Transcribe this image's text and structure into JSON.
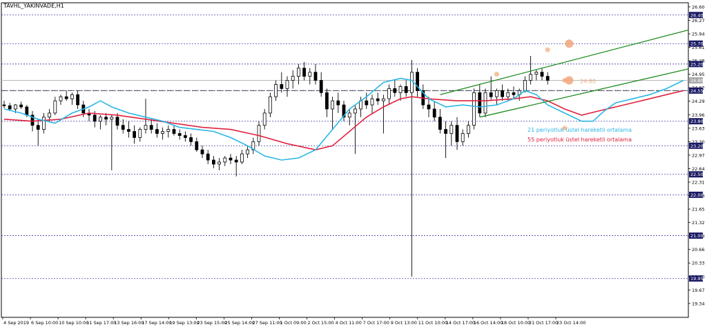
{
  "chart_data": {
    "type": "candlestick",
    "title": "TAVHL_YAKINVADE,H1",
    "ylim": [
      19.0,
      26.7
    ],
    "y_ticks": [
      "26.60",
      "26.27",
      "25.94",
      "25.61",
      "25.28",
      "24.95",
      "24.62",
      "24.29",
      "23.96",
      "23.63",
      "23.30",
      "22.97",
      "22.64",
      "22.31",
      "21.98",
      "21.65",
      "21.32",
      "20.99",
      "20.66",
      "20.33",
      "20.00",
      "19.67",
      "19.34"
    ],
    "price_labels": [
      {
        "label": "26.40",
        "value": 26.4,
        "color": "#1a1a66"
      },
      {
        "label": "25.70",
        "value": 25.7,
        "color": "#1a1a66"
      },
      {
        "label": "25.20",
        "value": 25.2,
        "color": "#1a1a66"
      },
      {
        "label": "24.80",
        "value": 24.8,
        "color": "#a8a8a8"
      },
      {
        "label": "24.55",
        "value": 24.55,
        "color": "#1a1a66"
      },
      {
        "label": "23.80",
        "value": 23.8,
        "color": "#1a1a66"
      },
      {
        "label": "23.20",
        "value": 23.2,
        "color": "#1a1a66"
      },
      {
        "label": "22.50",
        "value": 22.5,
        "color": "#1a1a66"
      },
      {
        "label": "22.00",
        "value": 22.0,
        "color": "#1a1a66"
      },
      {
        "label": "21.00",
        "value": 21.0,
        "color": "#1a1a66"
      },
      {
        "label": "19.95",
        "value": 19.95,
        "color": "#1a1a66"
      }
    ],
    "x_ticks": [
      "4 Sep 2019",
      "6 Sep 10:00",
      "10 Sep 10:00",
      "11 Sep 17:00",
      "13 Sep 16:00",
      "17 Sep 14:00",
      "19 Sep 13:00",
      "23 Sep 15:00",
      "25 Sep 14:00",
      "27 Sep 11:00",
      "1 Oct 09:00",
      "2 Oct 15:00",
      "4 Oct 11:00",
      "7 Oct 17:00",
      "9 Oct 13:00",
      "11 Oct 10:00",
      "14 Oct 17:00",
      "16 Oct 14:00",
      "18 Oct 10:00",
      "21 Oct 17:00",
      "23 Oct 14:00"
    ],
    "support_resistance": [
      26.4,
      25.7,
      25.2,
      24.55,
      23.8,
      23.2,
      22.5,
      22.0,
      21.0,
      19.95
    ],
    "dashed_level": 24.55,
    "gray_level": 24.8,
    "ema21_color": "#29b6e6",
    "ema55_color": "#e0203c",
    "channel_color": "#1d8a1d",
    "marker_color": "#f2a678",
    "annotations": {
      "level_text": "24.80",
      "ema21_legend": "21 periyotluk üstel hareketli ortalama",
      "ema55_legend": "55 periyotluk üstel hareketli ortalama"
    },
    "ema21": [
      [
        0,
        24.1
      ],
      [
        3,
        24.0
      ],
      [
        6,
        23.85
      ],
      [
        9,
        23.75
      ],
      [
        12,
        24.0
      ],
      [
        15,
        24.15
      ],
      [
        17,
        24.3
      ],
      [
        19,
        24.15
      ],
      [
        22,
        24.0
      ],
      [
        25,
        23.9
      ],
      [
        28,
        23.8
      ],
      [
        31,
        23.65
      ],
      [
        34,
        23.6
      ],
      [
        37,
        23.55
      ],
      [
        40,
        23.4
      ],
      [
        43,
        23.2
      ],
      [
        46,
        22.95
      ],
      [
        49,
        22.85
      ],
      [
        52,
        22.9
      ],
      [
        55,
        23.1
      ],
      [
        58,
        23.6
      ],
      [
        61,
        24.1
      ],
      [
        64,
        24.4
      ],
      [
        67,
        24.75
      ],
      [
        70,
        24.85
      ],
      [
        72,
        24.8
      ],
      [
        75,
        24.35
      ],
      [
        78,
        24.15
      ],
      [
        81,
        24.2
      ],
      [
        84,
        24.15
      ],
      [
        87,
        24.2
      ],
      [
        90,
        24.35
      ],
      [
        92,
        24.55
      ],
      [
        94,
        24.45
      ],
      [
        96,
        24.2
      ],
      [
        99,
        24.0
      ],
      [
        102,
        23.8
      ],
      [
        104,
        23.8
      ],
      [
        106,
        24.05
      ],
      [
        108,
        24.25
      ],
      [
        111,
        24.35
      ],
      [
        114,
        24.45
      ],
      [
        117,
        24.6
      ],
      [
        120,
        24.8
      ]
    ],
    "ema55": [
      [
        0,
        23.85
      ],
      [
        5,
        23.8
      ],
      [
        10,
        23.85
      ],
      [
        15,
        24.0
      ],
      [
        20,
        23.95
      ],
      [
        25,
        23.85
      ],
      [
        30,
        23.75
      ],
      [
        35,
        23.65
      ],
      [
        40,
        23.6
      ],
      [
        45,
        23.45
      ],
      [
        50,
        23.25
      ],
      [
        55,
        23.1
      ],
      [
        58,
        23.2
      ],
      [
        61,
        23.55
      ],
      [
        64,
        23.9
      ],
      [
        67,
        24.15
      ],
      [
        70,
        24.35
      ],
      [
        72,
        24.4
      ],
      [
        75,
        24.35
      ],
      [
        80,
        24.3
      ],
      [
        85,
        24.3
      ],
      [
        90,
        24.35
      ],
      [
        93,
        24.4
      ],
      [
        96,
        24.3
      ],
      [
        99,
        24.1
      ],
      [
        102,
        23.95
      ],
      [
        105,
        24.05
      ],
      [
        108,
        24.15
      ],
      [
        111,
        24.25
      ],
      [
        114,
        24.35
      ],
      [
        117,
        24.45
      ],
      [
        120,
        24.55
      ]
    ],
    "candles": [
      [
        24.2,
        24.3,
        24.12,
        24.18
      ],
      [
        24.18,
        24.25,
        24.05,
        24.1
      ],
      [
        24.1,
        24.22,
        24.0,
        24.2
      ],
      [
        24.2,
        24.28,
        24.1,
        24.15
      ],
      [
        24.15,
        24.2,
        23.9,
        23.95
      ],
      [
        23.95,
        24.05,
        23.55,
        23.7
      ],
      [
        23.7,
        23.85,
        23.2,
        23.6
      ],
      [
        23.6,
        24.0,
        23.5,
        23.9
      ],
      [
        23.9,
        24.1,
        23.8,
        24.0
      ],
      [
        24.0,
        24.4,
        23.95,
        24.3
      ],
      [
        24.3,
        24.45,
        24.2,
        24.4
      ],
      [
        24.4,
        24.55,
        24.3,
        24.35
      ],
      [
        24.35,
        24.5,
        24.2,
        24.45
      ],
      [
        24.45,
        24.55,
        24.1,
        24.2
      ],
      [
        24.2,
        24.3,
        23.9,
        24.0
      ],
      [
        24.0,
        24.1,
        23.8,
        23.95
      ],
      [
        23.95,
        24.05,
        23.65,
        23.8
      ],
      [
        23.8,
        23.95,
        23.6,
        23.9
      ],
      [
        23.9,
        24.0,
        23.7,
        23.85
      ],
      [
        23.85,
        23.95,
        22.6,
        23.9
      ],
      [
        23.9,
        24.0,
        23.6,
        23.7
      ],
      [
        23.7,
        23.85,
        23.5,
        23.6
      ],
      [
        23.6,
        23.8,
        23.4,
        23.55
      ],
      [
        23.55,
        23.7,
        23.25,
        23.4
      ],
      [
        23.4,
        23.65,
        23.3,
        23.6
      ],
      [
        23.6,
        24.35,
        23.5,
        23.7
      ],
      [
        23.7,
        23.85,
        23.5,
        23.6
      ],
      [
        23.6,
        23.75,
        23.4,
        23.5
      ],
      [
        23.5,
        23.65,
        23.35,
        23.55
      ],
      [
        23.55,
        23.7,
        23.4,
        23.6
      ],
      [
        23.6,
        23.7,
        23.45,
        23.5
      ],
      [
        23.5,
        23.6,
        23.35,
        23.45
      ],
      [
        23.45,
        23.55,
        23.3,
        23.4
      ],
      [
        23.4,
        23.5,
        23.2,
        23.3
      ],
      [
        23.3,
        23.4,
        23.05,
        23.1
      ],
      [
        23.1,
        23.2,
        22.9,
        23.0
      ],
      [
        23.0,
        23.1,
        22.75,
        22.85
      ],
      [
        22.85,
        22.95,
        22.65,
        22.75
      ],
      [
        22.75,
        22.9,
        22.6,
        22.8
      ],
      [
        22.8,
        22.95,
        22.7,
        22.9
      ],
      [
        22.9,
        23.0,
        22.75,
        22.85
      ],
      [
        22.85,
        22.95,
        22.45,
        22.8
      ],
      [
        22.8,
        23.1,
        22.75,
        23.0
      ],
      [
        23.0,
        23.2,
        22.9,
        23.1
      ],
      [
        23.1,
        23.4,
        23.0,
        23.3
      ],
      [
        23.3,
        23.8,
        23.2,
        23.7
      ],
      [
        23.7,
        24.1,
        23.6,
        24.0
      ],
      [
        24.0,
        24.5,
        23.9,
        24.4
      ],
      [
        24.4,
        24.8,
        24.3,
        24.7
      ],
      [
        24.7,
        25.0,
        24.5,
        24.6
      ],
      [
        24.6,
        24.9,
        24.4,
        24.8
      ],
      [
        24.8,
        25.05,
        24.6,
        24.9
      ],
      [
        24.9,
        25.2,
        24.7,
        25.1
      ],
      [
        25.1,
        25.25,
        24.8,
        24.9
      ],
      [
        24.9,
        25.1,
        24.7,
        25.0
      ],
      [
        25.0,
        25.2,
        24.7,
        24.8
      ],
      [
        24.8,
        25.0,
        24.4,
        24.5
      ],
      [
        24.5,
        24.6,
        23.9,
        24.1
      ],
      [
        24.1,
        24.4,
        23.6,
        24.3
      ],
      [
        24.3,
        24.5,
        24.0,
        24.2
      ],
      [
        24.2,
        24.3,
        23.8,
        23.9
      ],
      [
        23.9,
        24.1,
        23.7,
        24.0
      ],
      [
        24.0,
        24.2,
        23.0,
        24.1
      ],
      [
        24.1,
        24.4,
        23.9,
        24.3
      ],
      [
        24.3,
        24.5,
        24.1,
        24.2
      ],
      [
        24.2,
        24.45,
        24.0,
        24.35
      ],
      [
        24.35,
        24.5,
        24.2,
        24.3
      ],
      [
        24.3,
        24.45,
        23.5,
        24.35
      ],
      [
        24.35,
        24.7,
        24.2,
        24.6
      ],
      [
        24.6,
        24.8,
        24.4,
        24.5
      ],
      [
        24.5,
        24.7,
        24.3,
        24.65
      ],
      [
        24.65,
        24.8,
        24.4,
        24.5
      ],
      [
        24.5,
        25.3,
        20.0,
        25.0
      ],
      [
        25.0,
        25.1,
        24.4,
        24.55
      ],
      [
        24.55,
        24.7,
        24.1,
        24.2
      ],
      [
        24.2,
        24.4,
        23.9,
        24.1
      ],
      [
        24.1,
        24.3,
        23.8,
        23.9
      ],
      [
        23.9,
        24.1,
        23.5,
        23.6
      ],
      [
        23.6,
        23.8,
        22.9,
        23.5
      ],
      [
        23.5,
        23.8,
        23.2,
        23.7
      ],
      [
        23.7,
        23.9,
        23.1,
        23.3
      ],
      [
        23.3,
        23.6,
        23.2,
        23.5
      ],
      [
        23.5,
        23.8,
        23.4,
        23.7
      ],
      [
        23.7,
        24.6,
        23.6,
        24.5
      ],
      [
        24.5,
        24.7,
        23.9,
        24.0
      ],
      [
        24.0,
        24.6,
        23.9,
        24.5
      ],
      [
        24.5,
        24.9,
        24.3,
        24.4
      ],
      [
        24.4,
        24.6,
        24.2,
        24.55
      ],
      [
        24.55,
        24.7,
        24.3,
        24.4
      ],
      [
        24.4,
        24.6,
        24.3,
        24.5
      ],
      [
        24.5,
        24.65,
        24.35,
        24.45
      ],
      [
        24.45,
        24.6,
        24.3,
        24.55
      ],
      [
        24.55,
        24.9,
        24.5,
        24.8
      ],
      [
        24.8,
        25.4,
        24.7,
        24.95
      ],
      [
        24.95,
        25.05,
        24.8,
        25.0
      ],
      [
        25.0,
        25.1,
        24.8,
        24.9
      ],
      [
        24.9,
        25.0,
        24.7,
        24.8
      ]
    ]
  }
}
